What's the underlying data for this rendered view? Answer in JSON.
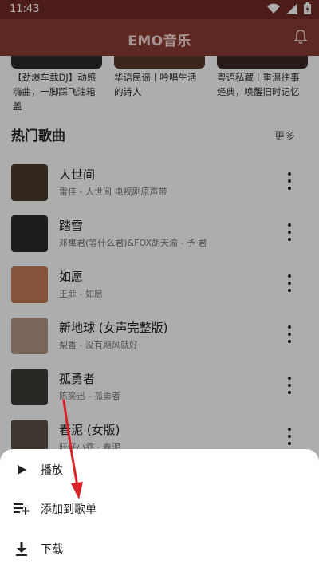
{
  "status": {
    "time": "11:43"
  },
  "appbar": {
    "title": "EMO音乐"
  },
  "top_cards": [
    {
      "caption": "【劲爆车载DJ】动感嗨曲，一脚踩飞油箱盖"
    },
    {
      "caption": "华语民谣丨吟唱生活的诗人"
    },
    {
      "caption": "粤语私藏丨重温往事经典，唤醒旧时记忆"
    }
  ],
  "section": {
    "title": "热门歌曲",
    "more": "更多"
  },
  "songs": [
    {
      "name": "人世间",
      "sub": "雷佳 - 人世间 电视剧原声带",
      "cover": "#4a3a2c"
    },
    {
      "name": "踏雪",
      "sub": "邓寓君(等什么君)&FOX胡天渝 - 予·君",
      "cover": "#2b2b2b"
    },
    {
      "name": "如愿",
      "sub": "王菲 - 如愿",
      "cover": "#c47d58"
    },
    {
      "name": "新地球 (女声完整版)",
      "sub": "梨香 - 没有飓风就好",
      "cover": "#b39784"
    },
    {
      "name": "孤勇者",
      "sub": "陈奕迅 - 孤勇者",
      "cover": "#3d3a36"
    },
    {
      "name": "春泥 (女版)",
      "sub": "旺仔小乔 - 春泥",
      "cover": "#5b4f45"
    }
  ],
  "sheet": {
    "items": [
      {
        "label": "播放",
        "icon": "play-icon"
      },
      {
        "label": "添加到歌单",
        "icon": "playlist-add-icon"
      },
      {
        "label": "下载",
        "icon": "download-icon"
      }
    ]
  },
  "colors": {
    "appbar": "#8a3a33",
    "statusbar": "#6f2a24",
    "arrow": "#d9232b"
  }
}
